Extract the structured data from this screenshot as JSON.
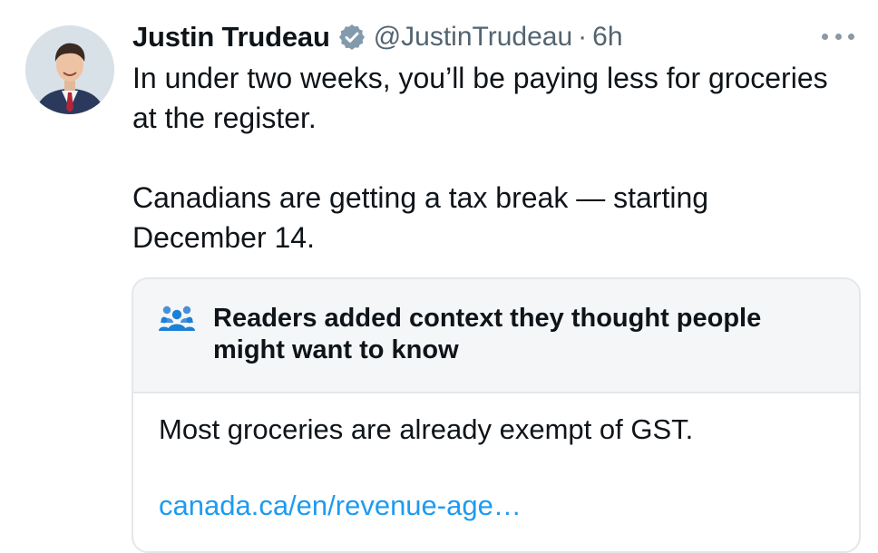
{
  "tweet": {
    "author": {
      "display_name": "Justin Trudeau",
      "handle": "@JustinTrudeau",
      "verified_icon": "verified-badge-icon"
    },
    "separator": "·",
    "time": "6h",
    "more_icon": "more-options-icon",
    "text": {
      "paragraph_1": "In under two weeks, you’ll be paying less for groceries at the register.",
      "paragraph_2": "Canadians are getting a tax break — starting December 14."
    }
  },
  "community_note": {
    "icon": "people-icon",
    "title": "Readers added context they thought people might want to know",
    "body": "Most groceries are already exempt of GST.",
    "link_text": "canada.ca/en/revenue-age…"
  },
  "colors": {
    "text_primary": "#0f1419",
    "text_secondary": "#536471",
    "accent_link": "#1d9bf0",
    "note_icon": "#1d9bf0",
    "note_header_bg": "#f4f6f7",
    "border": "#e3e7eb"
  }
}
